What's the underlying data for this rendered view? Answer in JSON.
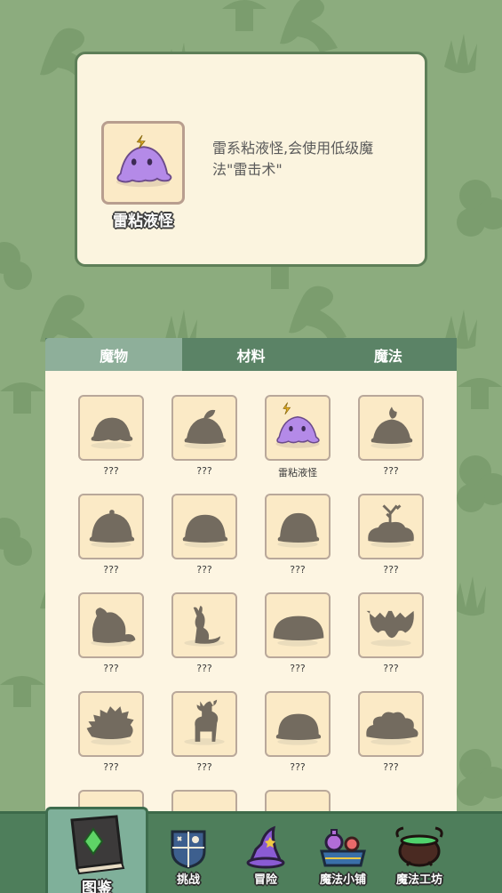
{
  "detail": {
    "name": "雷粘液怪",
    "description": "雷系粘液怪,会使用低级魔法\"雷击术\"",
    "icon": "purple-slime-lightning"
  },
  "tabs": [
    {
      "label": "魔物",
      "active": true
    },
    {
      "label": "材料",
      "active": false
    },
    {
      "label": "魔法",
      "active": false
    }
  ],
  "monsters": [
    {
      "label": "???",
      "icon": "slime-silhouette",
      "discovered": false
    },
    {
      "label": "???",
      "icon": "leaf-slime-silhouette",
      "discovered": false
    },
    {
      "label": "雷粘液怪",
      "icon": "purple-slime-lightning",
      "discovered": true
    },
    {
      "label": "???",
      "icon": "fire-slime-silhouette",
      "discovered": false
    },
    {
      "label": "???",
      "icon": "bell-slime-silhouette",
      "discovered": false
    },
    {
      "label": "???",
      "icon": "dome-slime-silhouette",
      "discovered": false
    },
    {
      "label": "???",
      "icon": "round-slime-silhouette",
      "discovered": false
    },
    {
      "label": "???",
      "icon": "tree-mound-silhouette",
      "discovered": false
    },
    {
      "label": "???",
      "icon": "beast-silhouette",
      "discovered": false
    },
    {
      "label": "???",
      "icon": "kangaroo-silhouette",
      "discovered": false
    },
    {
      "label": "???",
      "icon": "flat-mound-silhouette",
      "discovered": false
    },
    {
      "label": "???",
      "icon": "bat-silhouette",
      "discovered": false
    },
    {
      "label": "???",
      "icon": "hedgehog-silhouette",
      "discovered": false
    },
    {
      "label": "???",
      "icon": "deer-silhouette",
      "discovered": false
    },
    {
      "label": "???",
      "icon": "blob-silhouette",
      "discovered": false
    },
    {
      "label": "???",
      "icon": "cloud-mound-silhouette",
      "discovered": false
    },
    {
      "label": "",
      "icon": "hidden",
      "discovered": false
    },
    {
      "label": "",
      "icon": "hidden",
      "discovered": false
    },
    {
      "label": "",
      "icon": "hidden",
      "discovered": false
    }
  ],
  "nav": [
    {
      "label": "图鉴",
      "icon": "book-icon",
      "active": true
    },
    {
      "label": "挑战",
      "icon": "shield-icon",
      "active": false
    },
    {
      "label": "冒险",
      "icon": "wizard-hat-icon",
      "active": false
    },
    {
      "label": "魔法小铺",
      "icon": "potion-shop-icon",
      "active": false
    },
    {
      "label": "魔法工坊",
      "icon": "cauldron-icon",
      "active": false
    }
  ],
  "colors": {
    "background": "#8cac7e",
    "card": "#fbf4df",
    "tab_bar": "#5b8366",
    "tab_active": "#8eaf9a",
    "nav": "#4e7e5b",
    "silhouette": "#736b5f",
    "slime": "#b48ae8"
  }
}
